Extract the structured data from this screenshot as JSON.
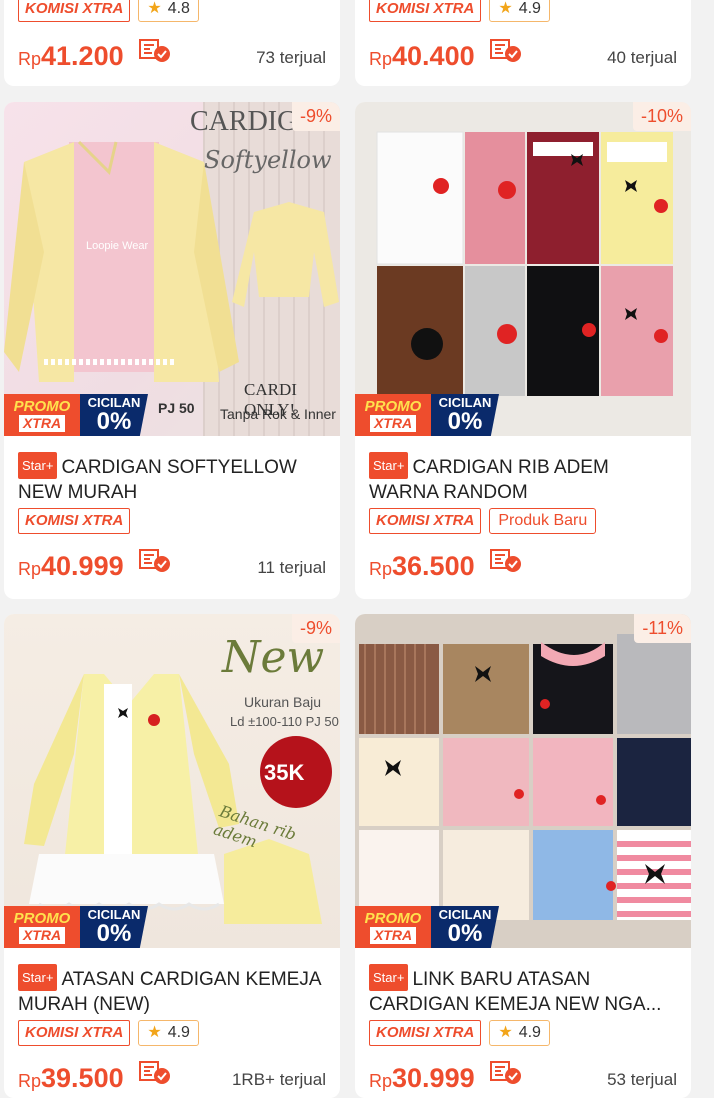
{
  "cards": [
    {
      "id": "top-left",
      "tags": {
        "komisi": "KOMISI XTRA",
        "rating": "4.8"
      },
      "price": {
        "currency": "Rp",
        "value": "41.200"
      },
      "sold": "73 terjual"
    },
    {
      "id": "top-right",
      "tags": {
        "komisi": "KOMISI XTRA",
        "rating": "4.9"
      },
      "price": {
        "currency": "Rp",
        "value": "40.400"
      },
      "sold": "40 terjual"
    },
    {
      "id": "mid-left",
      "discount": "-9%",
      "image_text": [
        "CARDIGAN",
        "Softyellow",
        "CARDI ONLY!",
        "Tanpa Rok & Inner",
        "PJ 50",
        "Loopie Wear"
      ],
      "promo": {
        "line1": "PROMO",
        "line2": "XTRA",
        "cicilan": "CICILAN",
        "cicilan_value": "0%"
      },
      "star": "Star+",
      "title": "CARDIGAN SOFTYELLOW NEW MURAH",
      "tags": {
        "komisi": "KOMISI XTRA"
      },
      "price": {
        "currency": "Rp",
        "value": "40.999"
      },
      "sold": "11 terjual"
    },
    {
      "id": "mid-right",
      "discount": "-10%",
      "promo": {
        "line1": "PROMO",
        "line2": "XTRA",
        "cicilan": "CICILAN",
        "cicilan_value": "0%"
      },
      "star": "Star+",
      "title": "CARDIGAN RIB ADEM WARNA RANDOM",
      "tags": {
        "komisi": "KOMISI XTRA",
        "baru": "Produk Baru"
      },
      "price": {
        "currency": "Rp",
        "value": "36.500"
      }
    },
    {
      "id": "bottom-left",
      "discount": "-9%",
      "image_text": [
        "New",
        "Ukuran Baju",
        "Ld ±100-110 PJ 50",
        "35K",
        "Bahan rib adem"
      ],
      "promo": {
        "line1": "PROMO",
        "line2": "XTRA",
        "cicilan": "CICILAN",
        "cicilan_value": "0%"
      },
      "star": "Star+",
      "title": "ATASAN CARDIGAN KEMEJA MURAH  (NEW)",
      "tags": {
        "komisi": "KOMISI XTRA",
        "rating": "4.9"
      },
      "price": {
        "currency": "Rp",
        "value": "39.500"
      },
      "sold": "1RB+ terjual"
    },
    {
      "id": "bottom-right",
      "discount": "-11%",
      "promo": {
        "line1": "PROMO",
        "line2": "XTRA",
        "cicilan": "CICILAN",
        "cicilan_value": "0%"
      },
      "star": "Star+",
      "title": "LINK BARU ATASAN CARDIGAN KEMEJA NEW NGA...",
      "tags": {
        "komisi": "KOMISI XTRA",
        "rating": "4.9"
      },
      "price": {
        "currency": "Rp",
        "value": "30.999"
      },
      "sold": "53 terjual"
    }
  ],
  "colors": {
    "accent": "#ee4d2d",
    "background": "#f2f2f2",
    "card": "#ffffff",
    "star": "#f2a51a"
  },
  "icons": {
    "installment": "installment-check-icon",
    "star": "star-icon"
  }
}
